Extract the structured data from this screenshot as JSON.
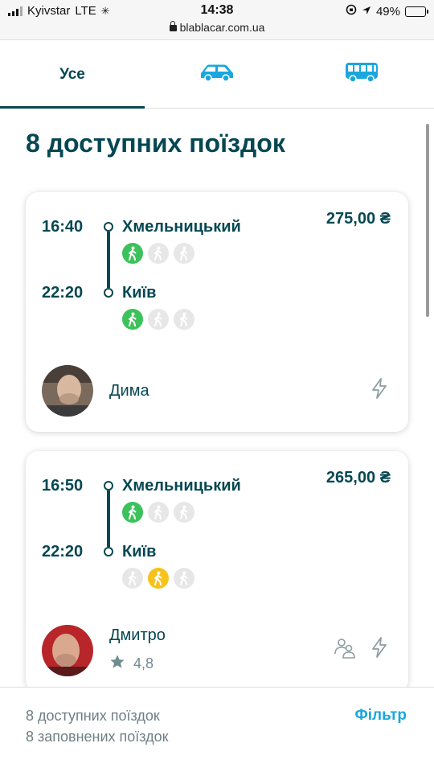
{
  "status_bar": {
    "carrier": "Kyivstar",
    "network": "LTE",
    "time": "14:38",
    "battery": "49%",
    "url": "blablacar.com.ua"
  },
  "tabs": [
    {
      "label": "Усе",
      "icon": "",
      "active": true
    },
    {
      "label": "",
      "icon": "car-icon",
      "active": false
    },
    {
      "label": "",
      "icon": "bus-icon",
      "active": false
    }
  ],
  "main": {
    "title": "8 доступних поїздок"
  },
  "rides": [
    {
      "departure_time": "16:40",
      "departure_city": "Хмельницький",
      "arrival_time": "22:20",
      "arrival_city": "Київ",
      "price": "275,00 ₴",
      "driver_name": "Дима",
      "rating": ""
    },
    {
      "departure_time": "16:50",
      "departure_city": "Хмельницький",
      "arrival_time": "22:20",
      "arrival_city": "Київ",
      "price": "265,00 ₴",
      "driver_name": "Дмитро",
      "rating": "4,8"
    }
  ],
  "footer": {
    "available": "8 доступних поїздок",
    "full": "8 заповнених поїздок",
    "filter_label": "Фільтр"
  },
  "colors": {
    "primary": "#054752",
    "accent": "#19a7de",
    "walk_green": "#3cc25b",
    "walk_yellow": "#f7c21b",
    "battery": "#f5c518"
  }
}
